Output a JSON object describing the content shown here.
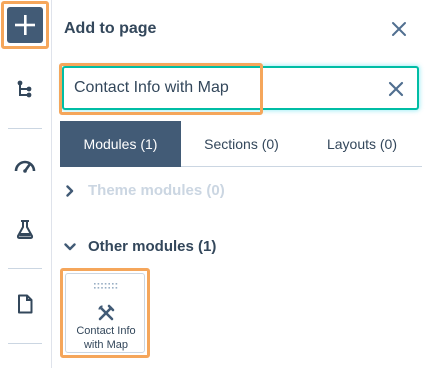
{
  "panel": {
    "title": "Add to page"
  },
  "search": {
    "value": "Contact Info with Map",
    "placeholder": ""
  },
  "tabs": [
    {
      "label": "Modules (1)",
      "active": true
    },
    {
      "label": "Sections (0)",
      "active": false
    },
    {
      "label": "Layouts (0)",
      "active": false
    }
  ],
  "sections": [
    {
      "label": "Theme modules (0)",
      "expanded": false
    },
    {
      "label": "Other modules (1)",
      "expanded": true
    }
  ],
  "module_card": {
    "line1": "Contact Info",
    "line2": "with Map",
    "icon": "tools-icon"
  },
  "rail": {
    "icons": [
      "plus-icon",
      "tree-icon",
      "gauge-icon",
      "flask-icon",
      "page-icon"
    ]
  },
  "colors": {
    "accent": "#425b76",
    "highlight": "#f5a65b",
    "focus": "#00bda5",
    "text": "#33475b",
    "muted": "#cbd6e2"
  }
}
